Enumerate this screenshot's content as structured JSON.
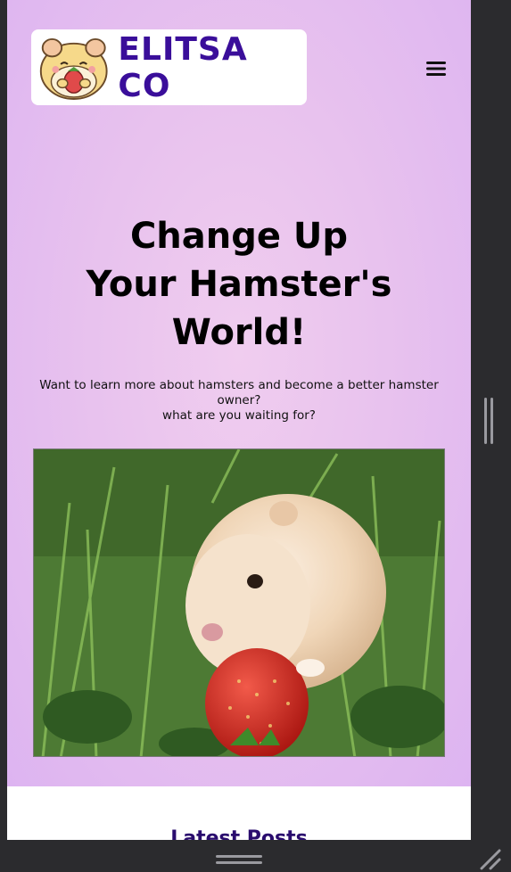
{
  "header": {
    "brand_name": "ELITSA CO",
    "logo_icon": "hamster-strawberry-logo",
    "menu_icon": "hamburger-menu-icon"
  },
  "hero": {
    "title_lines": [
      "Change Up",
      "Your Hamster's",
      "World!"
    ],
    "subtitle_lines": [
      "Want to learn more about hamsters and become a better hamster",
      "owner?",
      "what are you waiting for?"
    ],
    "photo_icon": "hamster-eating-strawberry-photo"
  },
  "section": {
    "heading": "Latest Posts"
  },
  "colors": {
    "brand": "#3a0e9a",
    "hero_bg": "#e8c2ee",
    "frame": "#2b2b2e"
  }
}
